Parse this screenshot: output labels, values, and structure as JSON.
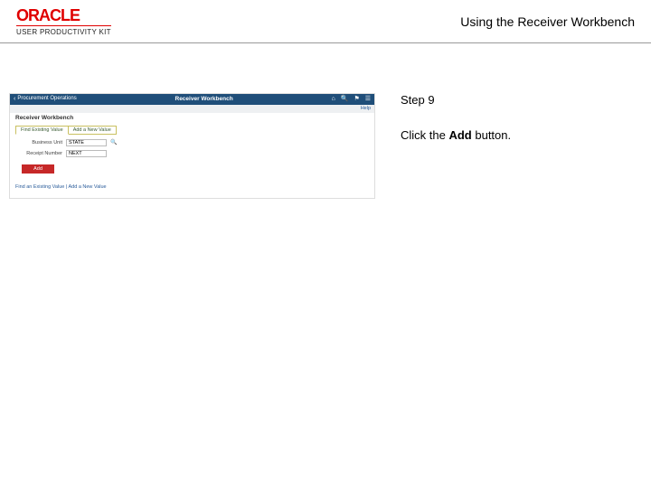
{
  "header": {
    "logo": "ORACLE",
    "subbrand": "USER PRODUCTIVITY KIT",
    "doc_title": "Using the Receiver Workbench"
  },
  "instructions": {
    "step_label": "Step 9",
    "step_text_prefix": "Click the ",
    "step_text_bold": "Add",
    "step_text_suffix": " button."
  },
  "app": {
    "back_label": "Procurement Operations",
    "center_title": "Receiver Workbench",
    "help_label": "Help",
    "section_title": "Receiver Workbench",
    "tabs": {
      "a": "Find Existing Value",
      "b": "Add a New Value"
    },
    "form": {
      "bu_label": "Business Unit",
      "bu_value": "STATE",
      "id_label": "Receipt Number",
      "id_value": "NEXT"
    },
    "add_label": "Add",
    "foot": "Find an Existing Value | Add a New Value"
  }
}
